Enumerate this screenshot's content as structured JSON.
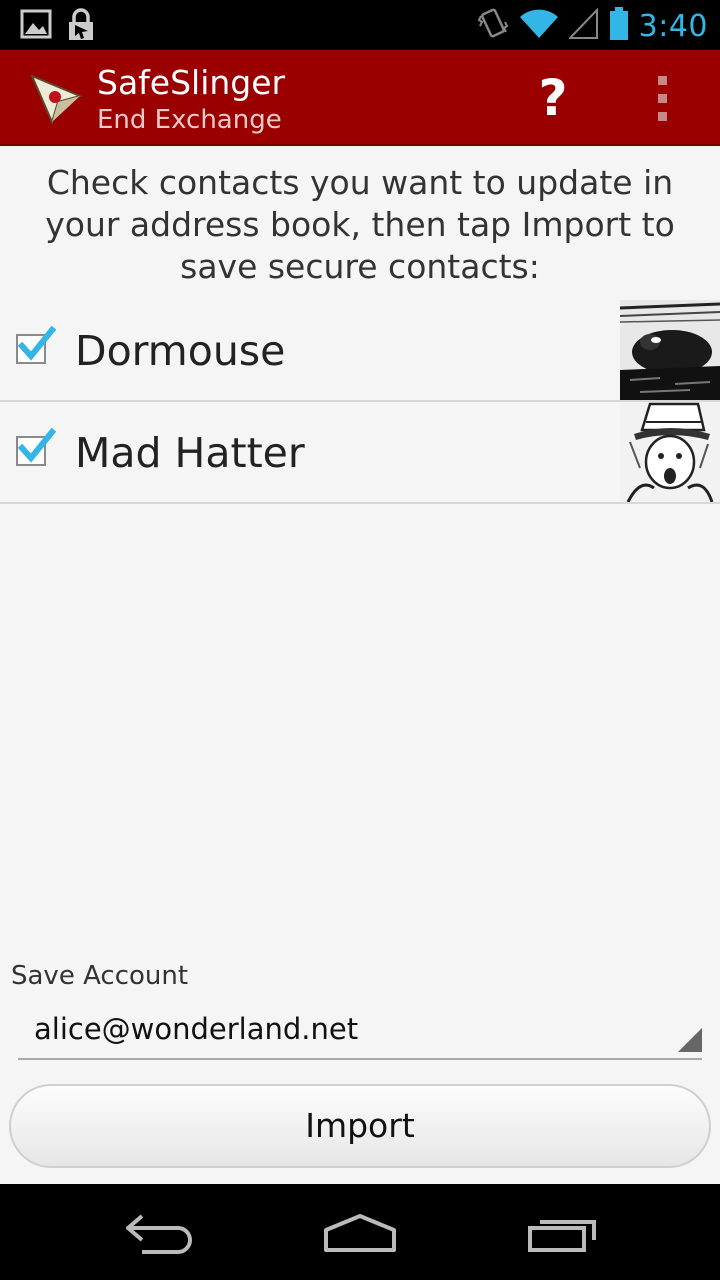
{
  "status_bar": {
    "time": "3:40",
    "left_icons": [
      "image-notification-icon",
      "lock-notification-icon"
    ],
    "right_icons": [
      "vibrate-icon",
      "wifi-icon",
      "cell-signal-icon",
      "battery-icon"
    ],
    "accent_color": "#33b5e5"
  },
  "action_bar": {
    "title": "SafeSlinger",
    "subtitle": "End Exchange",
    "help_label": "?",
    "background_color": "#9b0000"
  },
  "main": {
    "instructions": "Check contacts you want to update in your address book, then tap Import to save secure contacts:",
    "contacts": [
      {
        "name": "Dormouse",
        "checked": true
      },
      {
        "name": "Mad Hatter",
        "checked": true
      }
    ],
    "save_account_label": "Save Account",
    "save_account_value": "alice@wonderland.net",
    "import_label": "Import"
  },
  "nav_bar": {
    "icons": [
      "back-icon",
      "home-icon",
      "recent-apps-icon"
    ]
  }
}
